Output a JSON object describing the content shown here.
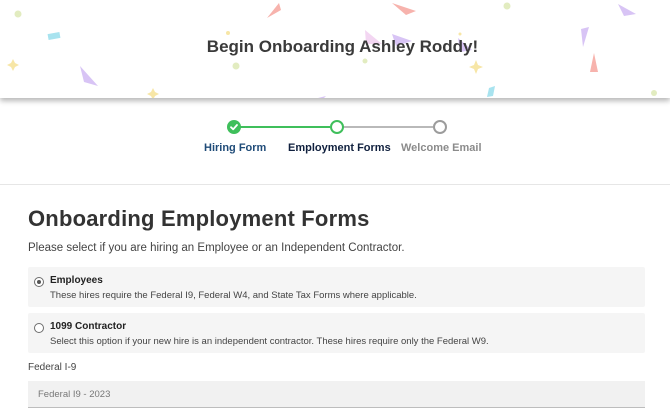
{
  "banner": {
    "title": "Begin Onboarding Ashley Roddy!"
  },
  "stepper": {
    "steps": [
      {
        "label": "Hiring Form",
        "status": "completed"
      },
      {
        "label": "Employment Forms",
        "status": "current"
      },
      {
        "label": "Welcome Email",
        "status": "upcoming"
      }
    ]
  },
  "form": {
    "title": "Onboarding Employment Forms",
    "subtitle": "Please select if you are hiring an Employee or an Independent Contractor.",
    "options": [
      {
        "title": "Employees",
        "description": "These hires require the Federal I9, Federal W4, and State Tax Forms where applicable.",
        "selected": true
      },
      {
        "title": "1099 Contractor",
        "description": "Select this option if your new hire is an independent contractor. These hires require only the Federal W9.",
        "selected": false
      }
    ],
    "federal_i9": {
      "label": "Federal I-9",
      "value": "Federal I9 - 2023"
    }
  },
  "colors": {
    "completed": "#3fbf5b",
    "current_label": "#10203e",
    "upcoming": "#9c9c9c"
  },
  "icons": {
    "completed_step": "check-icon"
  }
}
